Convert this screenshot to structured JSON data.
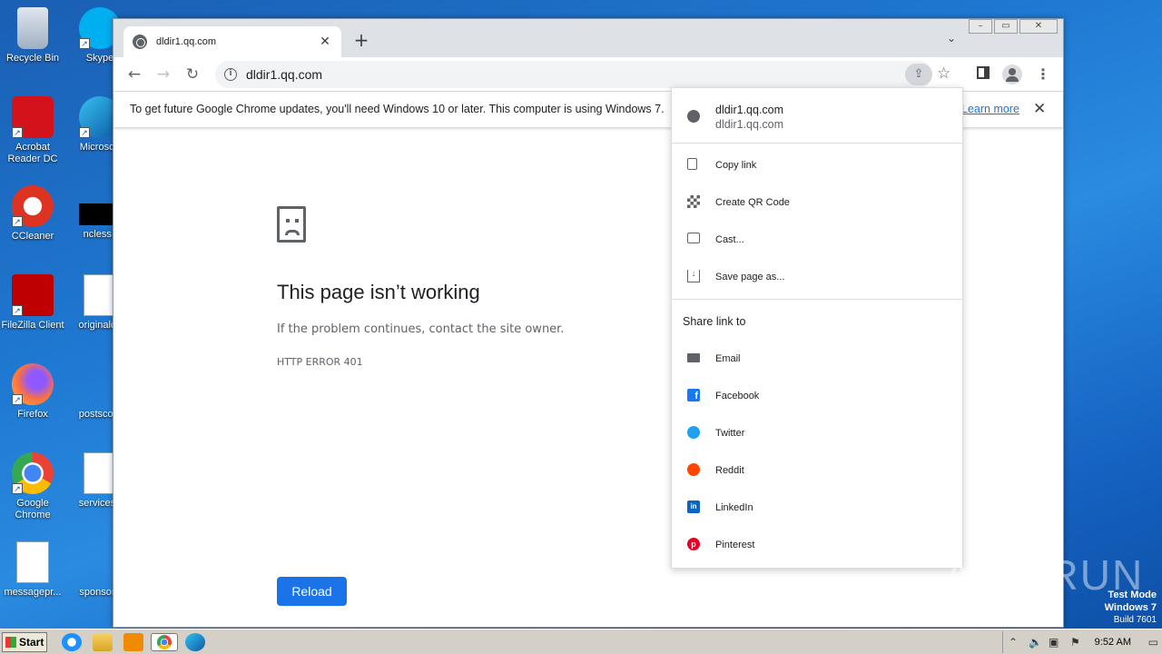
{
  "desktop": {
    "icons": [
      {
        "label": "Recycle Bin"
      },
      {
        "label": "Skype"
      },
      {
        "label": "Acrobat Reader DC"
      },
      {
        "label": "Microsoft"
      },
      {
        "label": "CCleaner"
      },
      {
        "label": "ncless.j"
      },
      {
        "label": "FileZilla Client"
      },
      {
        "label": "originalce"
      },
      {
        "label": "Firefox"
      },
      {
        "label": "postsconl"
      },
      {
        "label": "Google Chrome"
      },
      {
        "label": "servicesp"
      },
      {
        "label": "messagepr..."
      },
      {
        "label": "sponsore"
      }
    ],
    "watermark": "ANY RUN",
    "test_mode": {
      "line1": "Test Mode",
      "line2": "Windows 7",
      "line3": "Build 7601"
    }
  },
  "browser": {
    "tab": {
      "title": "dldir1.qq.com",
      "close_icon": "close-icon"
    },
    "new_tab_label": "+",
    "address": {
      "url": "dldir1.qq.com"
    },
    "infobar": {
      "message": "To get future Google Chrome updates, you'll need Windows 10 or later. This computer is using Windows 7.",
      "link": "Learn more"
    },
    "error": {
      "title": "This page isn’t working",
      "description": "If the problem continues, contact the site owner.",
      "code": "HTTP ERROR 401",
      "reload_label": "Reload"
    },
    "share_menu": {
      "header_title": "dldir1.qq.com",
      "header_subtitle": "dldir1.qq.com",
      "actions": [
        {
          "label": "Copy link",
          "icon": "copy-icon"
        },
        {
          "label": "Create QR Code",
          "icon": "qr-code-icon"
        },
        {
          "label": "Cast...",
          "icon": "cast-icon"
        },
        {
          "label": "Save page as...",
          "icon": "download-icon"
        }
      ],
      "share_to_label": "Share link to",
      "targets": [
        {
          "label": "Email",
          "icon": "email-icon",
          "color": "#5f6368"
        },
        {
          "label": "Facebook",
          "icon": "facebook-icon",
          "color": "#1877f2"
        },
        {
          "label": "Twitter",
          "icon": "twitter-icon",
          "color": "#1da1f2"
        },
        {
          "label": "Reddit",
          "icon": "reddit-icon",
          "color": "#ff4500"
        },
        {
          "label": "LinkedIn",
          "icon": "linkedin-icon",
          "color": "#0a66c2"
        },
        {
          "label": "Pinterest",
          "icon": "pinterest-icon",
          "color": "#e60023"
        }
      ]
    }
  },
  "taskbar": {
    "start_label": "Start",
    "clock": "9:52 AM"
  },
  "colors": {
    "accent": "#1a73e8",
    "desktop_bg": "#1f78d1"
  }
}
